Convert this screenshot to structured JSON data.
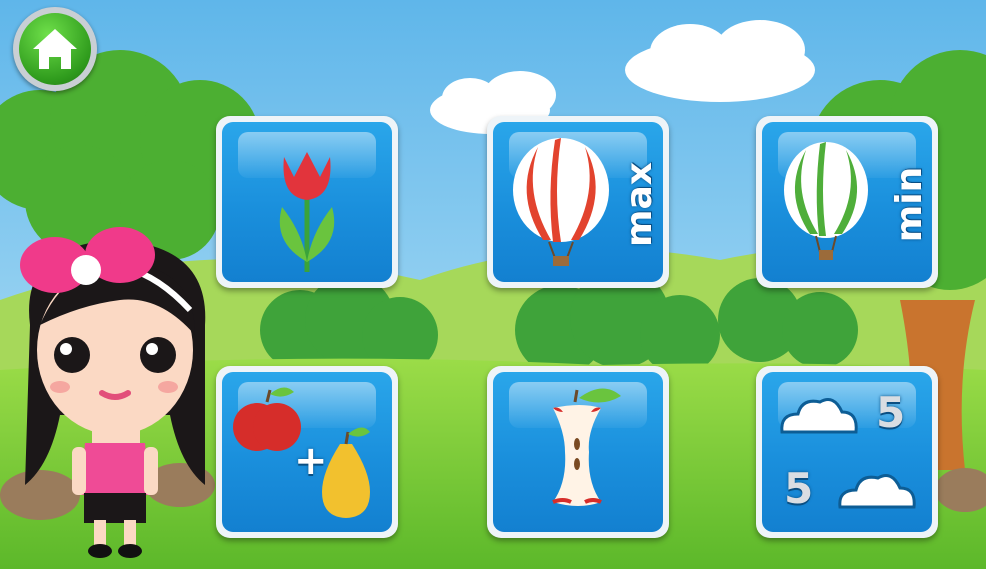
{
  "home_button": {
    "icon": "home-icon"
  },
  "tiles": [
    {
      "id": "flower",
      "icon": "tulip-icon"
    },
    {
      "id": "max",
      "icon": "red-balloon-icon",
      "label": "max"
    },
    {
      "id": "min",
      "icon": "green-balloon-icon",
      "label": "min"
    },
    {
      "id": "addition",
      "icon": "apple-plus-pear-icon",
      "operator": "+"
    },
    {
      "id": "apple-core",
      "icon": "apple-core-icon"
    },
    {
      "id": "counting",
      "icon": "clouds-number-icon",
      "number_top": "5",
      "number_bottom": "5"
    }
  ],
  "colors": {
    "sky": "#7fc8ee",
    "grass": "#7ccd3b",
    "tile_blue": "#1a8fdc",
    "home_green": "#2e9a1c"
  }
}
